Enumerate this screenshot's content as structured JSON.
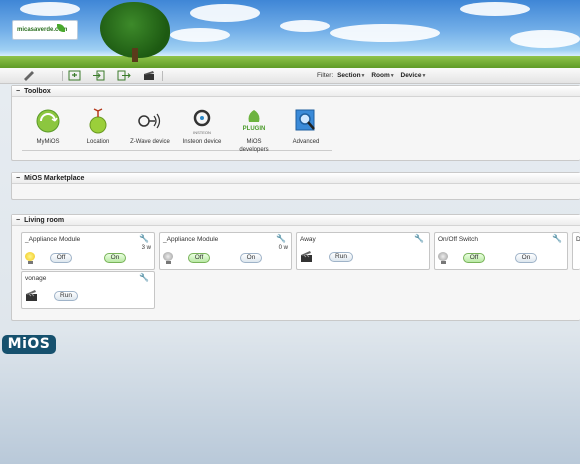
{
  "banner": {
    "logo_text": "micasaverde.com"
  },
  "toolbar": {
    "filter_label": "Filter:",
    "filters": [
      {
        "label": "Section"
      },
      {
        "label": "Room"
      },
      {
        "label": "Device"
      }
    ]
  },
  "toolbox": {
    "title": "Toolbox",
    "items": [
      {
        "label": "MyMiOS",
        "icon": "mymios-icon"
      },
      {
        "label": "Location",
        "icon": "location-icon"
      },
      {
        "label": "Z-Wave device",
        "icon": "zwave-icon"
      },
      {
        "label": "Insteon device",
        "icon": "insteon-icon"
      },
      {
        "label": "MiOS developers",
        "icon": "plugin-icon",
        "badge": "PLUGIN"
      },
      {
        "label": "Advanced",
        "icon": "advanced-icon"
      }
    ],
    "insteon_brand": "INSTEON"
  },
  "marketplace": {
    "title": "MiOS Marketplace"
  },
  "living_room": {
    "title": "Living room",
    "devices": [
      {
        "name": "_Appliance Module",
        "power": "3 w",
        "off": "Off",
        "on": "On",
        "state": "on"
      },
      {
        "name": "_Appliance Module",
        "power": "0 w",
        "off": "Off",
        "on": "On",
        "state": "off"
      },
      {
        "name": "Away",
        "run": "Run"
      },
      {
        "name": "On/Off Switch",
        "off": "Off",
        "on": "On",
        "state": "off"
      },
      {
        "name": "D"
      },
      {
        "name": "vonage",
        "run": "Run"
      }
    ]
  },
  "brand": {
    "logo": "MiOS"
  },
  "colors": {
    "accent": "#16516e",
    "on_green": "#b9e8a4"
  }
}
